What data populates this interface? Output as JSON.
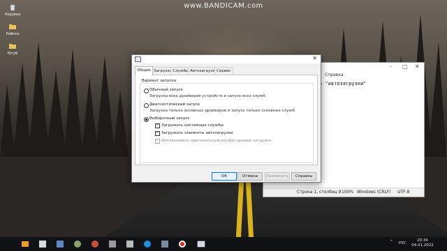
{
  "watermark": "www.BANDICAM.com",
  "desktop_icons": [
    {
      "label": "Корзина",
      "icon": "recycle-bin-icon"
    },
    {
      "label": "Работа",
      "icon": "folder-icon"
    },
    {
      "label": "Ютуб",
      "icon": "folder-icon"
    }
  ],
  "notepad": {
    "menu": [
      "д",
      "Справка"
    ],
    "text": "з \"автозагрузки\"",
    "status": {
      "position": "Строка 1, столбец 9",
      "zoom": "100%",
      "line_endings": "Windows (CRLF)",
      "encoding": "UTF-8"
    }
  },
  "dialog": {
    "close_glyph": "✕",
    "tabs": [
      "Общие",
      "Загрузка",
      "Службы",
      "Автозагрузка",
      "Сервис"
    ],
    "active_tab": "Общие",
    "group_label": "Вариант запуска",
    "options": [
      {
        "label": "Обычный запуск",
        "desc": "Загрузка всех драйверов устройств и запуск всех служб",
        "selected": false
      },
      {
        "label": "Диагностический запуск",
        "desc": "Загрузка только основных драйверов и запуск только основных служб",
        "selected": false
      },
      {
        "label": "Выборочный запуск",
        "desc": "",
        "selected": true
      }
    ],
    "checkboxes": [
      {
        "label": "Загружать системные службы",
        "checked": true,
        "disabled": false
      },
      {
        "label": "Загружать элементы автозагрузки",
        "checked": true,
        "disabled": false
      },
      {
        "label": "Использовать оригинальную конфигурацию загрузки",
        "checked": true,
        "disabled": true
      }
    ],
    "buttons": {
      "ok": "ОК",
      "cancel": "Отмена",
      "apply": "Применить",
      "help": "Справка"
    }
  },
  "taskbar": {
    "language": "РУС",
    "time": "20:30",
    "date": "04.01.2022"
  }
}
